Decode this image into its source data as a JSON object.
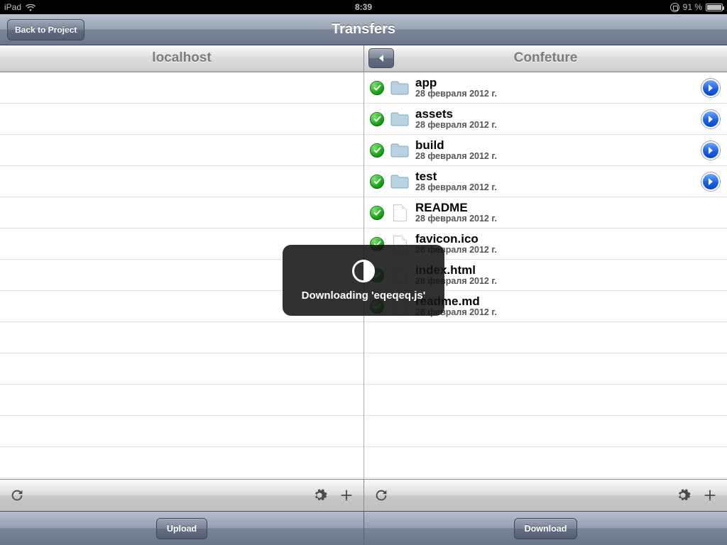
{
  "status": {
    "device": "iPad",
    "time": "8:39",
    "battery_pct": "91 %"
  },
  "nav": {
    "back_label": "Back to Project",
    "title": "Transfers"
  },
  "left": {
    "title": "localhost",
    "upload_label": "Upload"
  },
  "right": {
    "title": "Confeture",
    "download_label": "Download",
    "items": [
      {
        "name": "app",
        "date": "28 февраля 2012 г.",
        "type": "folder"
      },
      {
        "name": "assets",
        "date": "28 февраля 2012 г.",
        "type": "folder"
      },
      {
        "name": "build",
        "date": "28 февраля 2012 г.",
        "type": "folder"
      },
      {
        "name": "test",
        "date": "28 февраля 2012 г.",
        "type": "folder"
      },
      {
        "name": "README",
        "date": "28 февраля 2012 г.",
        "type": "file"
      },
      {
        "name": "favicon.ico",
        "date": "28 февраля 2012 г.",
        "type": "file"
      },
      {
        "name": "index.html",
        "date": "28 февраля 2012 г.",
        "type": "file"
      },
      {
        "name": "readme.md",
        "date": "28 февраля 2012 г.",
        "type": "file"
      }
    ]
  },
  "hud": {
    "message": "Downloading 'eqeqeq.js'"
  }
}
